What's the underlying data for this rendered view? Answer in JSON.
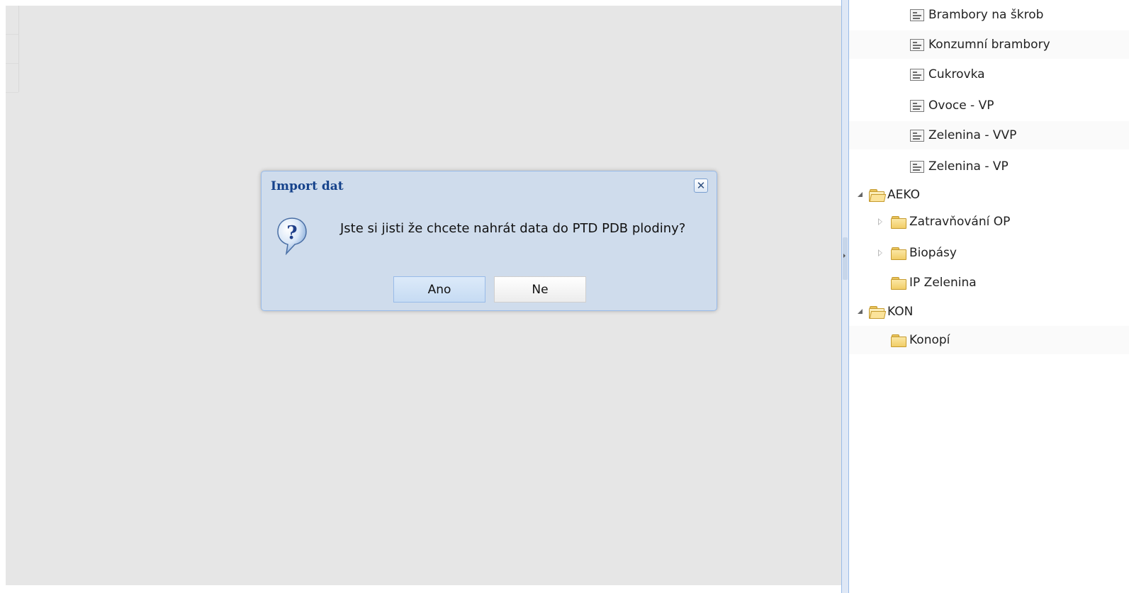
{
  "dialog": {
    "title": "Import dat",
    "message": "Jste si jisti že chcete nahrát data do PTD PDB plodiny?",
    "buttons": {
      "yes": "Ano",
      "no": "Ne"
    }
  },
  "tree": {
    "items": [
      {
        "label": "Brambory na škrob",
        "type": "leaf",
        "level": 2
      },
      {
        "label": "Konzumní brambory",
        "type": "leaf",
        "level": 2
      },
      {
        "label": "Cukrovka",
        "type": "leaf",
        "level": 2
      },
      {
        "label": "Ovoce - VP",
        "type": "leaf",
        "level": 2
      },
      {
        "label": "Zelenina - VVP",
        "type": "leaf",
        "level": 2
      },
      {
        "label": "Zelenina - VP",
        "type": "leaf",
        "level": 2
      },
      {
        "label": "AEKO",
        "type": "folder",
        "expanded": true,
        "level": 0
      },
      {
        "label": "Zatravňování OP",
        "type": "folder",
        "expanded": false,
        "level": 1
      },
      {
        "label": "Biopásy",
        "type": "folder",
        "expanded": false,
        "level": 1
      },
      {
        "label": "IP Zelenina",
        "type": "folder",
        "level": 1
      },
      {
        "label": "KON",
        "type": "folder",
        "expanded": true,
        "level": 0
      },
      {
        "label": "Konopí",
        "type": "folder",
        "level": 1
      }
    ]
  },
  "icons": {
    "dialog": "question-icon",
    "close": "close-icon",
    "folder": "folder-icon",
    "leaf": "document-icon"
  },
  "colors": {
    "dialog_title": "#15428b",
    "dialog_bg": "#cfdcec",
    "mask": "#e6e6e6"
  }
}
